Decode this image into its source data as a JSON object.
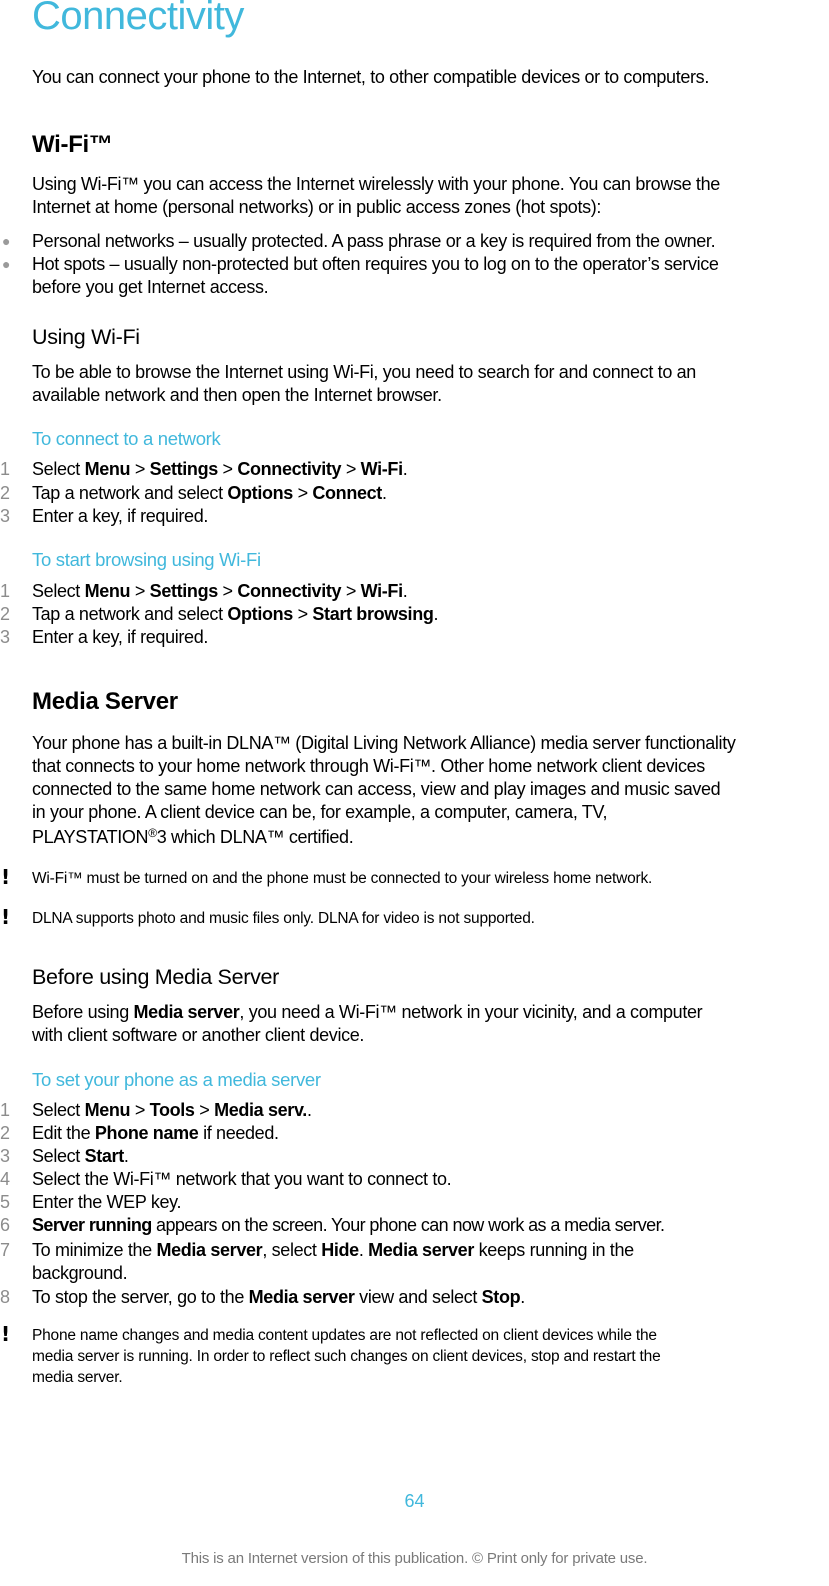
{
  "title": "Connectivity",
  "intro": "You can connect your phone to the Internet, to other compatible devices or to computers.",
  "wifi": {
    "heading": "Wi-Fi™",
    "para_line1": "Using Wi-Fi™ you can access the Internet wirelessly with your phone. You can browse the",
    "para_line2": "Internet at home (personal networks) or in public access zones (hot spots):",
    "bullets": [
      {
        "text": "Personal networks – usually protected. A pass phrase or a key is required from the owner."
      },
      {
        "text_line1": "Hot spots – usually non-protected but often requires you to log on to the operator’s service",
        "text_line2": "before you get Internet access."
      }
    ]
  },
  "using_wifi": {
    "heading": "Using Wi-Fi",
    "para_line1": "To be able to browse the Internet using Wi-Fi, you need to search for and connect to an",
    "para_line2": "available network and then open the Internet browser."
  },
  "connect_procedure": {
    "title": "To connect to a network",
    "steps": [
      {
        "num": "1",
        "pre": "Select ",
        "b1": "Menu",
        "s1": " > ",
        "b2": "Settings",
        "s2": " > ",
        "b3": "Connectivity",
        "s3": " > ",
        "b4": "Wi-Fi",
        "post": "."
      },
      {
        "num": "2",
        "pre": "Tap a network and select ",
        "b1": "Options",
        "s1": " > ",
        "b2": "Connect",
        "post": "."
      },
      {
        "num": "3",
        "text": "Enter a key, if required."
      }
    ]
  },
  "browse_procedure": {
    "title": "To start browsing using Wi-Fi",
    "steps": [
      {
        "num": "1",
        "pre": "Select ",
        "b1": "Menu",
        "s1": " > ",
        "b2": "Settings",
        "s2": " > ",
        "b3": "Connectivity",
        "s3": " > ",
        "b4": "Wi-Fi",
        "post": "."
      },
      {
        "num": "2",
        "pre": "Tap a network and select ",
        "b1": "Options",
        "s1": " > ",
        "b2": "Start browsing",
        "post": "."
      },
      {
        "num": "3",
        "text": "Enter a key, if required."
      }
    ]
  },
  "media_server": {
    "heading": "Media Server",
    "lines": [
      "Your phone has a built-in DLNA™ (Digital Living Network Alliance) media server functionality",
      "that connects to your home network through Wi-Fi™. Other home network client devices",
      "connected to the same home network can access, view and play images and music saved",
      "in your phone. A client device can be, for example, a computer, camera, TV,"
    ],
    "last_line_pre": "PLAYSTATION",
    "last_line_sup": "®",
    "last_line_post": "3 which DLNA™ certified.",
    "notes": [
      "Wi-Fi™ must be turned on and the phone must be connected to your wireless home network.",
      "DLNA supports photo and music files only. DLNA for video is not supported."
    ]
  },
  "before_using": {
    "heading": "Before using Media Server",
    "line1_pre": "Before using ",
    "line1_bold": "Media server",
    "line1_post": ", you need a Wi-Fi™ network in your vicinity, and a computer",
    "line2": "with client software or another client device."
  },
  "set_server_procedure": {
    "title": "To set your phone as a media server",
    "steps": [
      {
        "num": "1",
        "pre": "Select ",
        "b1": "Menu",
        "s1": " > ",
        "b2": "Tools",
        "s2": " > ",
        "b3": "Media serv.",
        "post": "."
      },
      {
        "num": "2",
        "pre": "Edit the ",
        "b1": "Phone name",
        "post": " if needed."
      },
      {
        "num": "3",
        "pre": "Select ",
        "b1": "Start",
        "post": "."
      },
      {
        "num": "4",
        "text": "Select the Wi-Fi™ network that you want to connect to."
      },
      {
        "num": "5",
        "text": "Enter the WEP key."
      },
      {
        "num": "6",
        "b1": "Server running",
        "post": " appears on the screen. Your phone can now work as a media server."
      },
      {
        "num": "7",
        "pre": "To minimize the ",
        "b1": "Media server",
        "s1": ", select ",
        "b2": "Hide",
        "s2": ". ",
        "b3": "Media server",
        "post": " keeps running in the",
        "line2": "background."
      },
      {
        "num": "8",
        "pre": "To stop the server, go to the ",
        "b1": "Media server",
        "s1": " view and select ",
        "b2": "Stop",
        "post": "."
      }
    ],
    "note_lines": [
      "Phone name changes and media content updates are not reflected on client devices while the",
      "media server is running. In order to reflect such changes on client devices, stop and restart the",
      "media server."
    ]
  },
  "page_number": "64",
  "footer": "This is an Internet version of this publication. © Print only for private use.",
  "colors": {
    "accent": "#41b8dc",
    "step_number": "#8c8c8c",
    "footer": "#7a7a7a"
  }
}
